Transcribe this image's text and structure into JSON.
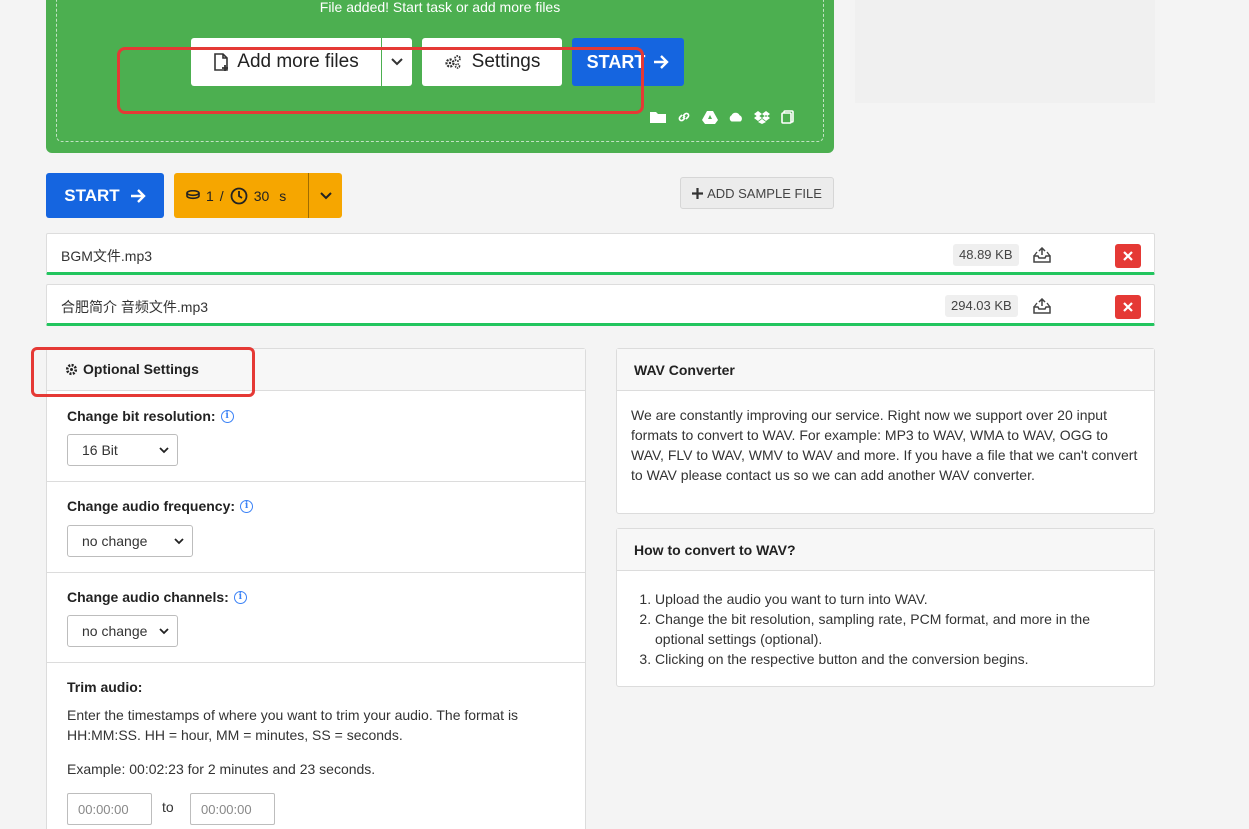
{
  "upload": {
    "status_text": "File added! Start task or add more files",
    "add_more_label": "Add more files",
    "settings_label": "Settings",
    "start_label": "START",
    "source_icons": [
      "folder-icon",
      "link-icon",
      "google-drive-icon",
      "onedrive-icon",
      "dropbox-icon",
      "paste-icon"
    ]
  },
  "toolbar": {
    "start_label": "START",
    "credits_count": "1",
    "credits_sep": "/",
    "time_value": "30",
    "time_unit": "s",
    "sample_label": "ADD SAMPLE FILE"
  },
  "files": [
    {
      "name": "BGM文件.mp3",
      "size": "48.89 KB"
    },
    {
      "name": "合肥简介 音频文件.mp3",
      "size": "294.03 KB"
    }
  ],
  "optional_settings": {
    "title": "Optional Settings",
    "bit_resolution": {
      "label": "Change bit resolution:",
      "value": "16 Bit"
    },
    "audio_frequency": {
      "label": "Change audio frequency:",
      "value": "no change"
    },
    "audio_channels": {
      "label": "Change audio channels:",
      "value": "no change"
    },
    "trim": {
      "label": "Trim audio:",
      "description": "Enter the timestamps of where you want to trim your audio. The format is HH:MM:SS. HH = hour, MM = minutes, SS = seconds.",
      "example": "Example: 00:02:23 for 2 minutes and 23 seconds.",
      "from_placeholder": "00:00:00",
      "to_label": "to",
      "to_placeholder": "00:00:00"
    }
  },
  "wav_info": {
    "title": "WAV Converter",
    "body": "We are constantly improving our service. Right now we support over 20 input formats to convert to WAV. For example: MP3 to WAV, WMA to WAV, OGG to WAV, FLV to WAV, WMV to WAV and more. If you have a file that we can't convert to WAV please contact us so we can add another WAV converter."
  },
  "howto": {
    "title": "How to convert to WAV?",
    "steps": [
      "Upload the audio you want to turn into WAV.",
      "Change the bit resolution, sampling rate, PCM format, and more in the optional settings (optional).",
      "Clicking on the respective button and the conversion begins."
    ]
  },
  "colors": {
    "upload_green": "#4caf50",
    "primary_blue": "#1565e0",
    "credits_orange": "#f6a600",
    "delete_red": "#e53935",
    "progress_green": "#22c55e",
    "highlight_red": "#e53935"
  }
}
